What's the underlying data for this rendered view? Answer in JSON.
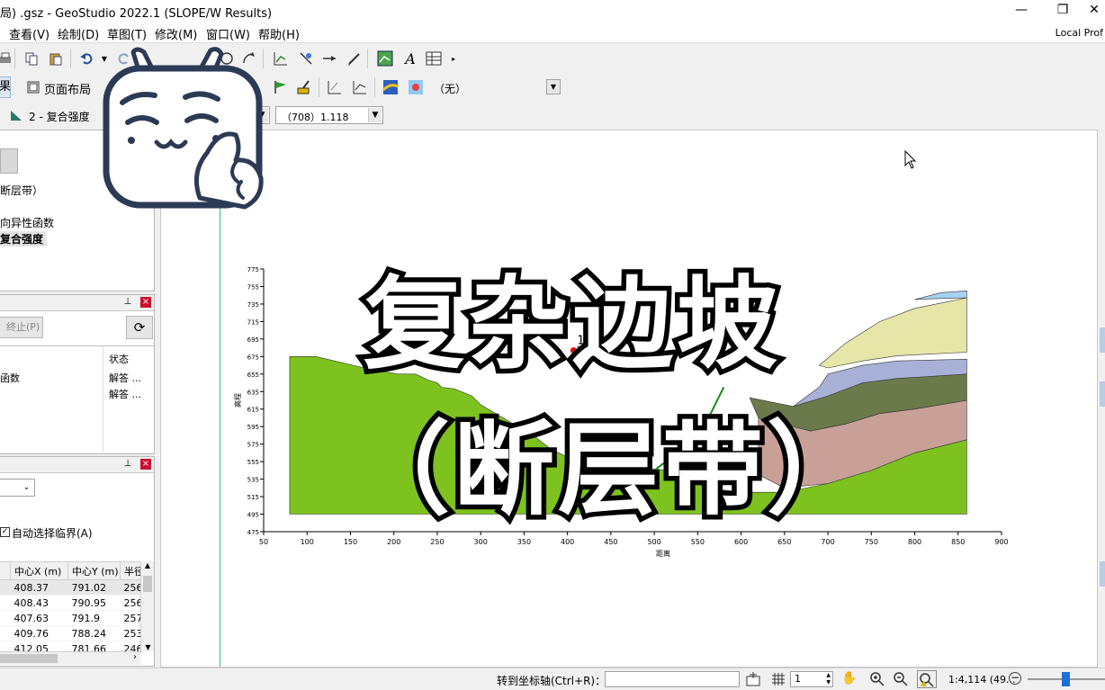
{
  "window": {
    "title": "局) .gsz - GeoStudio 2022.1 (SLOPE/W Results)",
    "controls": [
      "—",
      "❐",
      "✕"
    ]
  },
  "menubar": {
    "items": [
      "查看(V)",
      "绘制(D)",
      "草图(T)",
      "修改(M)",
      "窗口(W)",
      "帮助(H)"
    ],
    "right_label": "Local Prof"
  },
  "toolbar2": {
    "results_tab": "果",
    "page_layout": "页面布局",
    "none_select": "（无）"
  },
  "toolbar3": {
    "analysis_label": "2 - 复合强度",
    "slip_select": "（708）1.118"
  },
  "left_panel": {
    "tree_items": [
      "断层带）",
      "向异性函数",
      "复合强度"
    ],
    "solve": {
      "stop_button": "终止(P)",
      "status_header": "状态",
      "rows": [
        {
          "name": "函数",
          "status": "解答 ..."
        },
        {
          "name": "",
          "status": "解答 ..."
        }
      ]
    },
    "slip": {
      "auto_select_label": "自动选择临界(A)",
      "auto_select_checked": true,
      "columns": [
        "",
        "中心X (m)",
        "中心Y (m)",
        "半径"
      ],
      "rows": [
        [
          "",
          "408.37",
          "791.02",
          "256"
        ],
        [
          "",
          "408.43",
          "790.95",
          "256"
        ],
        [
          "",
          "407.63",
          "791.9",
          "257"
        ],
        [
          "",
          "409.76",
          "788.24",
          "253"
        ],
        [
          "",
          "412.05",
          "781.66",
          "246"
        ]
      ]
    }
  },
  "canvas": {
    "fos_label": "1.118",
    "ylabel": "高程",
    "xlabel": "距离",
    "overlay_line1": "复杂边坡",
    "overlay_line2": "（断层带）"
  },
  "chart_data": {
    "type": "area",
    "title": "",
    "xlabel": "距离",
    "ylabel": "高程",
    "xlim": [
      50,
      900
    ],
    "ylim": [
      475,
      775
    ],
    "x_ticks": [
      50,
      100,
      150,
      200,
      250,
      300,
      350,
      400,
      450,
      500,
      550,
      600,
      650,
      700,
      750,
      800,
      850,
      900
    ],
    "y_ticks": [
      475,
      495,
      515,
      535,
      555,
      575,
      595,
      615,
      635,
      655,
      675,
      695,
      715,
      735,
      755,
      775
    ],
    "factor_of_safety": 1.118,
    "fos_point": [
      407,
      682
    ],
    "layers": [
      {
        "name": "green",
        "color": "#7dc21e",
        "points": [
          [
            80,
            495
          ],
          [
            80,
            675
          ],
          [
            110,
            675
          ],
          [
            140,
            668
          ],
          [
            175,
            660
          ],
          [
            205,
            655
          ],
          [
            225,
            655
          ],
          [
            240,
            648
          ],
          [
            250,
            645
          ],
          [
            255,
            640
          ],
          [
            270,
            638
          ],
          [
            290,
            630
          ],
          [
            300,
            620
          ],
          [
            360,
            585
          ],
          [
            380,
            570
          ],
          [
            400,
            560
          ],
          [
            440,
            560
          ],
          [
            480,
            548
          ],
          [
            520,
            545
          ],
          [
            560,
            525
          ],
          [
            600,
            520
          ],
          [
            650,
            520
          ],
          [
            700,
            530
          ],
          [
            750,
            545
          ],
          [
            800,
            565
          ],
          [
            860,
            580
          ],
          [
            860,
            495
          ]
        ]
      },
      {
        "name": "pink",
        "color": "#c8a098",
        "points": [
          [
            620,
            605
          ],
          [
            680,
            590
          ],
          [
            720,
            598
          ],
          [
            760,
            610
          ],
          [
            800,
            615
          ],
          [
            860,
            625
          ],
          [
            860,
            580
          ],
          [
            800,
            565
          ],
          [
            750,
            545
          ],
          [
            700,
            530
          ],
          [
            650,
            525
          ],
          [
            620,
            540
          ]
        ]
      },
      {
        "name": "olive",
        "color": "#6b7a4a",
        "points": [
          [
            610,
            628
          ],
          [
            660,
            618
          ],
          [
            700,
            630
          ],
          [
            740,
            645
          ],
          [
            780,
            650
          ],
          [
            860,
            655
          ],
          [
            860,
            625
          ],
          [
            800,
            615
          ],
          [
            760,
            610
          ],
          [
            720,
            598
          ],
          [
            680,
            590
          ],
          [
            620,
            605
          ]
        ]
      },
      {
        "name": "lavender",
        "color": "#a8b0d8",
        "points": [
          [
            700,
            655
          ],
          [
            740,
            665
          ],
          [
            780,
            670
          ],
          [
            860,
            672
          ],
          [
            860,
            655
          ],
          [
            780,
            650
          ],
          [
            740,
            645
          ],
          [
            700,
            630
          ],
          [
            660,
            618
          ],
          [
            690,
            640
          ]
        ]
      },
      {
        "name": "cream",
        "color": "#e6e6a8",
        "points": [
          [
            690,
            665
          ],
          [
            720,
            690
          ],
          [
            760,
            715
          ],
          [
            800,
            730
          ],
          [
            860,
            742
          ],
          [
            860,
            680
          ],
          [
            780,
            676
          ],
          [
            740,
            670
          ],
          [
            700,
            662
          ]
        ]
      },
      {
        "name": "lightblue",
        "color": "#a8d0f0",
        "points": [
          [
            800,
            740
          ],
          [
            830,
            748
          ],
          [
            860,
            750
          ],
          [
            860,
            742
          ],
          [
            820,
            741
          ]
        ]
      }
    ]
  },
  "statusbar": {
    "goto_label": "转到坐标轴(Ctrl+R)：",
    "goto_value": "",
    "grid_value": "1",
    "scale_text": "1:4,114 (49..."
  }
}
